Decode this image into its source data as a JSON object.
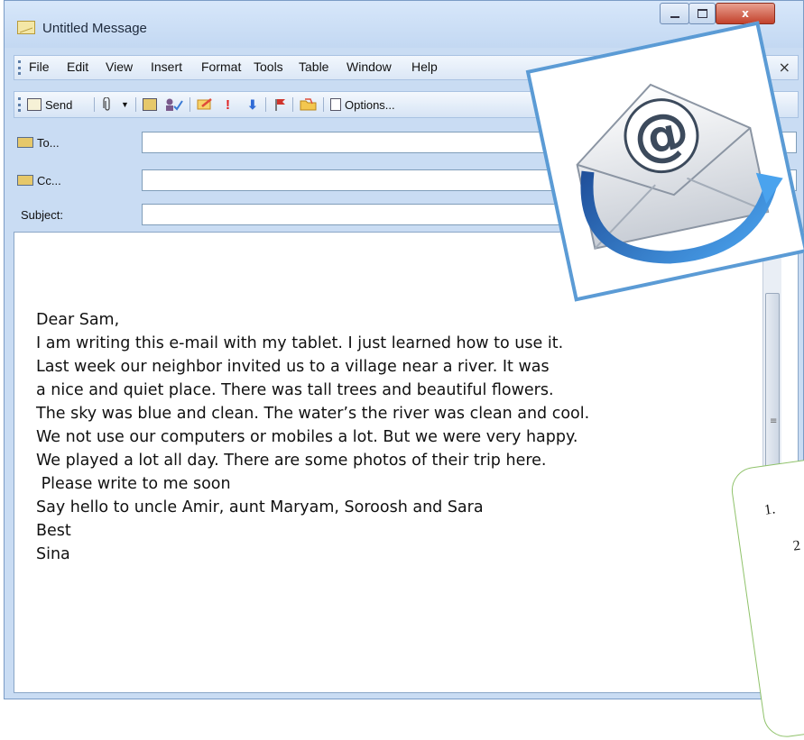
{
  "window": {
    "title": "Untitled Message",
    "close_glyph": "x"
  },
  "menu": {
    "items": [
      "File",
      "Edit",
      "View",
      "Insert",
      "Format",
      "Tools",
      "Table",
      "Window",
      "Help"
    ],
    "close_glyph": "×"
  },
  "toolbar": {
    "send_label": "Send",
    "options_label": "Options..."
  },
  "fields": {
    "to_label": "To...",
    "cc_label": "Cc...",
    "subject_label": "Subject:"
  },
  "message": {
    "lines": [
      "Dear Sam,",
      "I am writing this e-mail with my tablet. I just learned how to use it.",
      "Last week our neighbor invited us to a village near a river. It was",
      "a nice and quiet place. There was tall trees and beautiful flowers.",
      "The sky was blue and clean. The water’s the river was clean and cool.",
      "We not use our computers or mobiles a lot. But we were very happy.",
      "We played a lot all day. There are some photos of their trip here.",
      " Please write to me soon",
      "Say hello to uncle Amir, aunt Maryam, Soroosh and Sara",
      "Best",
      "Sina"
    ]
  },
  "callout": {
    "item1": "1.",
    "item2": "2"
  },
  "colors": {
    "accent": "#5b9bd5",
    "chrome": "#c9dcf3",
    "callout_border": "#8fc26a"
  },
  "icons": [
    "envelope-icon",
    "send-icon",
    "paperclip-icon",
    "address-book-icon",
    "check-names-icon",
    "importance-high-icon",
    "importance-low-icon",
    "flag-icon",
    "folder-icon",
    "options-icon",
    "email-at-icon"
  ]
}
